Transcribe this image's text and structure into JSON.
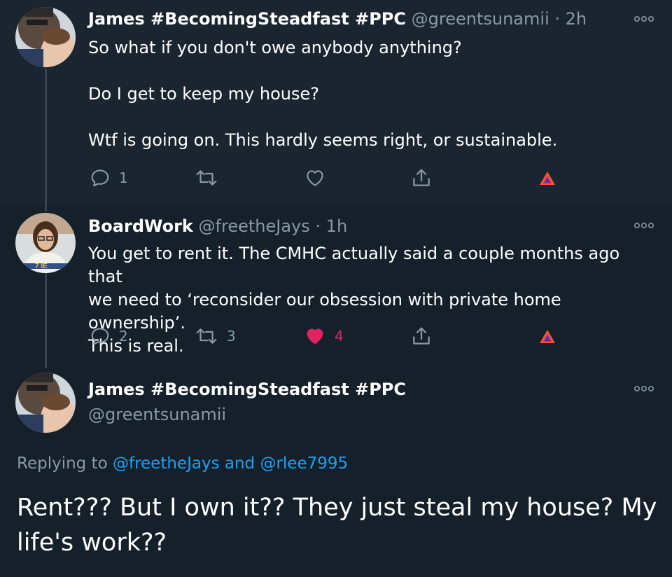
{
  "tweets": [
    {
      "name": "James #BecomingSteadfast #PPC",
      "handle": "@greentsunamii",
      "dot": "·",
      "time": "2h",
      "lines": [
        "So what if you don't owe anybody anything?",
        "Do I get to keep my house?",
        "Wtf is going on.  This hardly seems right, or sustainable."
      ],
      "reply_count": "1",
      "retweet_count": "",
      "like_count": "",
      "liked": false
    },
    {
      "name": "BoardWork",
      "handle": "@freetheJays",
      "dot": "·",
      "time": "1h",
      "lines": [
        "You get to rent it.  The CMHC actually said a couple months ago that",
        "we need to ‘reconsider our obsession with private home ownership’.",
        "This is real."
      ],
      "reply_count": "2",
      "retweet_count": "3",
      "like_count": "4",
      "liked": true
    }
  ],
  "focused": {
    "name": "James #BecomingSteadfast #PPC",
    "handle": "@greentsunamii",
    "replying_prefix": "Replying to",
    "replying_user1": "@freetheJays",
    "replying_and": "and",
    "replying_user2": "@rlee7995",
    "text_line1": "Rent???  But I own it??  They just steal my house?  My",
    "text_line2": "life's work??"
  },
  "icons": {
    "reply": "reply-bubble-icon",
    "retweet": "retweet-icon",
    "like": "heart-icon",
    "share": "share-icon",
    "brave": "brave-triangle-icon",
    "more": "more-options-icon"
  },
  "colors": {
    "background": "#15202b",
    "highlight_background": "#1b2530",
    "secondary_text": "#8899a6",
    "link": "#1da1f2",
    "like": "#e0245e",
    "thread_line": "#38444d"
  }
}
